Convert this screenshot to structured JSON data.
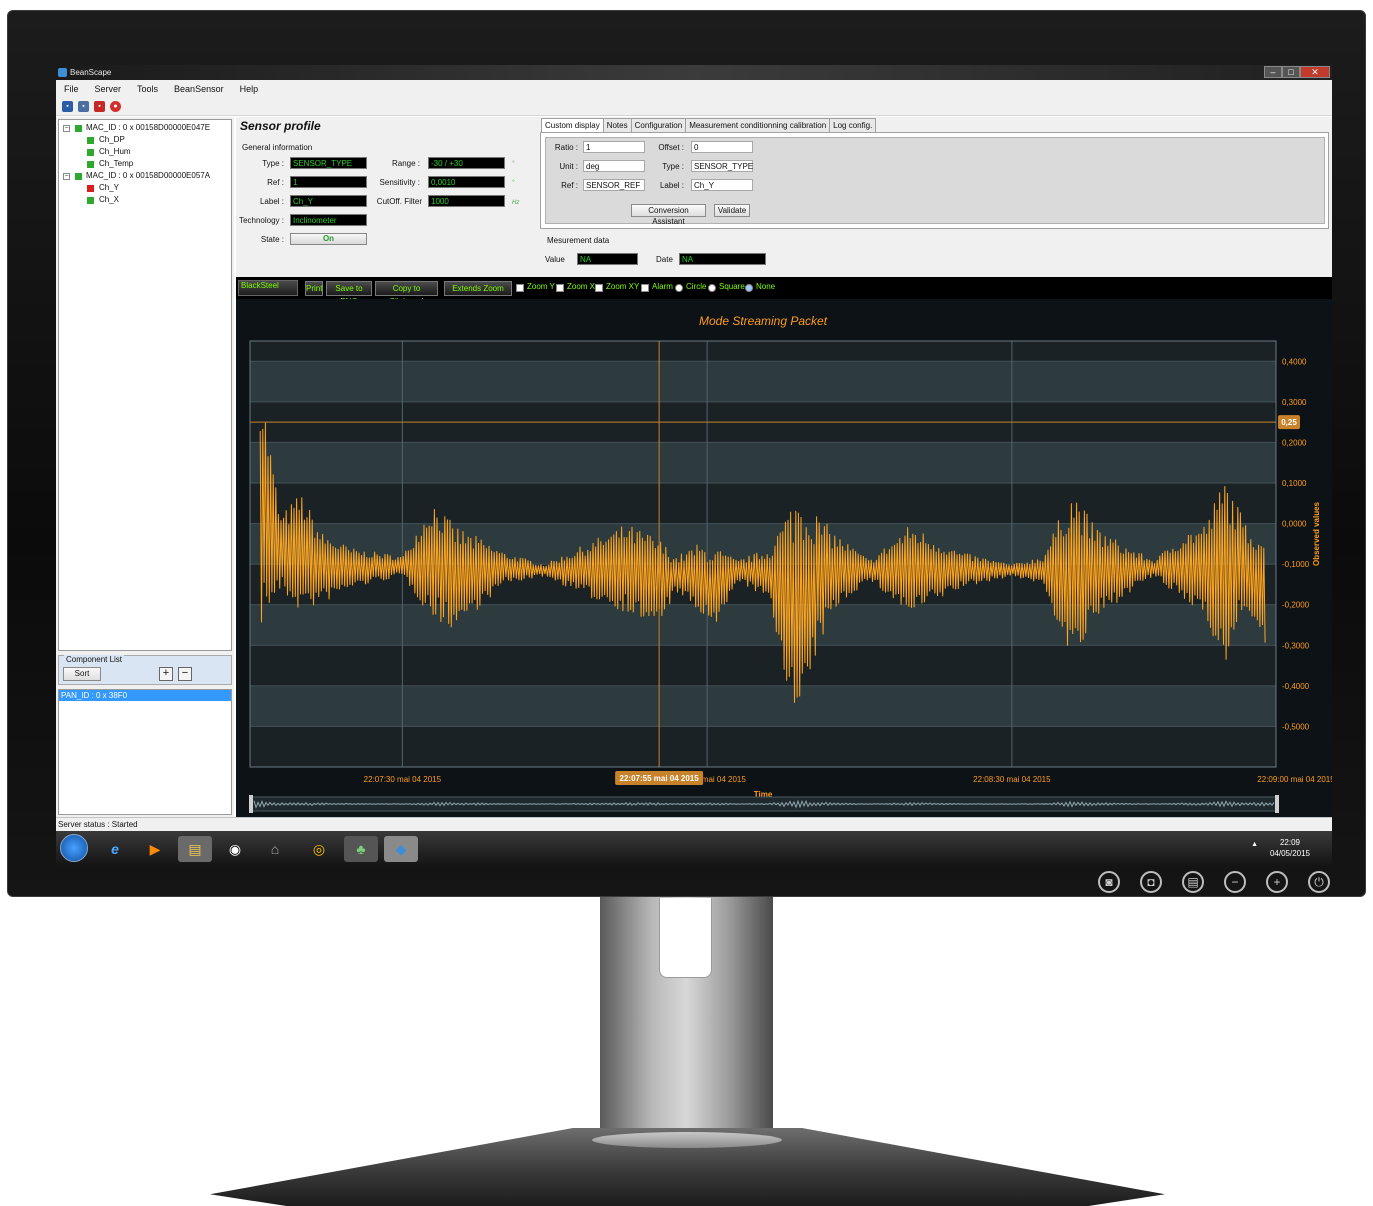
{
  "window": {
    "title": "BeanScape"
  },
  "menu": [
    "File",
    "Server",
    "Tools",
    "BeanSensor",
    "Help"
  ],
  "tree": [
    {
      "label": "MAC_ID : 0 x 00158D00000E047E",
      "level": 0,
      "status": "green",
      "expander": "−"
    },
    {
      "label": "Ch_DP",
      "level": 1,
      "status": "green"
    },
    {
      "label": "Ch_Hum",
      "level": 1,
      "status": "green"
    },
    {
      "label": "Ch_Temp",
      "level": 1,
      "status": "green"
    },
    {
      "label": "MAC_ID : 0 x 00158D00000E057A",
      "level": 0,
      "status": "green",
      "expander": "−"
    },
    {
      "label": "Ch_Y",
      "level": 1,
      "status": "red"
    },
    {
      "label": "Ch_X",
      "level": 1,
      "status": "green"
    }
  ],
  "component_list": {
    "title": "Component List",
    "sort_label": "Sort",
    "plus": "+",
    "minus": "−"
  },
  "pan_list": [
    "PAN_ID : 0 x 38F0"
  ],
  "status": "Server status : Started",
  "profile": {
    "title": "Sensor profile",
    "general_info": "General information",
    "type_label": "Type :",
    "type_value": "SENSOR_TYPE",
    "ref_label": "Ref :",
    "ref_value": "1",
    "label_label": "Label :",
    "label_value": "Ch_Y",
    "technology_label": "Technology :",
    "technology_value": "Inclinometer",
    "state_label": "State :",
    "state_value": "On",
    "range_label": "Range :",
    "range_value": "-30 / +30",
    "range_unit": "°",
    "sensitivity_label": "Sensitivity :",
    "sensitivity_value": "0,0010",
    "sensitivity_unit": "°",
    "cutoff_label": "CutOff. Filter",
    "cutoff_value": "1000",
    "cutoff_unit": "Hz"
  },
  "tabs": [
    "Custom display",
    "Notes",
    "Configuration",
    "Measurement conditionning calibration",
    "Log config."
  ],
  "custom_display": {
    "ratio_label": "Ratio :",
    "ratio_value": "1",
    "offset_label": "Offset :",
    "offset_value": "0",
    "unit_label": "Unit :",
    "unit_value": "deg",
    "type_label": "Type :",
    "type_value": "SENSOR_TYPE",
    "ref_label": "Ref :",
    "ref_value": "SENSOR_REF",
    "label_label": "Label :",
    "label_value": "Ch_Y",
    "conversion_button": "Conversion Assistant",
    "validate_button": "Validate"
  },
  "measurement": {
    "title": "Mesurement data",
    "value_label": "Value",
    "value": "NA",
    "date_label": "Date",
    "date": "NA"
  },
  "chart_toolbar": {
    "skin": "BlackSteel",
    "print": "Print",
    "save_png": "Save to PNG",
    "copy": "Copy to Clipboard",
    "extends_zoom": "Extends Zoom",
    "zoom_y": "Zoom Y",
    "zoom_x": "Zoom X",
    "zoom_xy": "Zoom XY",
    "alarm": "Alarm",
    "circle": "Circle",
    "square": "Square",
    "none": "None"
  },
  "chart_data": {
    "type": "line",
    "title": "Mode Streaming Packet",
    "xlabel": "Time",
    "ylabel": "Observed values",
    "ylim": [
      -0.6,
      0.45
    ],
    "y_ticks": [
      "0,4000",
      "0,3000",
      "0,2000",
      "0,1000",
      "0,0000",
      "-0,1000",
      "-0,2000",
      "-0,3000",
      "-0,4000",
      "-0,5000"
    ],
    "x_ticks": [
      "22:07:30 mai 04 2015",
      "22:08:00 mai 04 2015",
      "22:08:30 mai 04 2015",
      "22:09:00 mai 04 2015"
    ],
    "x_range_seconds": [
      -45,
      56
    ],
    "cursor_time_label": "22:07:55 mai 04 2015",
    "cursor_value_label": "0,25",
    "cursor_value": 0.25,
    "line_color": "#ffa51e",
    "grid": true,
    "envelope": [
      {
        "t": -44,
        "max": 0.37,
        "min": -0.26
      },
      {
        "t": -42,
        "max": 0.02,
        "min": -0.17
      },
      {
        "t": -40,
        "max": 0.08,
        "min": -0.22
      },
      {
        "t": -38,
        "max": -0.02,
        "min": -0.2
      },
      {
        "t": -35,
        "max": -0.06,
        "min": -0.16
      },
      {
        "t": -30,
        "max": -0.08,
        "min": -0.13
      },
      {
        "t": -27,
        "max": 0.06,
        "min": -0.24
      },
      {
        "t": -25,
        "max": 0.0,
        "min": -0.26
      },
      {
        "t": -22,
        "max": -0.04,
        "min": -0.2
      },
      {
        "t": -20,
        "max": -0.07,
        "min": -0.15
      },
      {
        "t": -16,
        "max": -0.1,
        "min": -0.13
      },
      {
        "t": -12,
        "max": -0.05,
        "min": -0.18
      },
      {
        "t": -8,
        "max": 0.0,
        "min": -0.22
      },
      {
        "t": -5,
        "max": -0.03,
        "min": -0.26
      },
      {
        "t": -3,
        "max": -0.08,
        "min": -0.17
      },
      {
        "t": -1,
        "max": -0.05,
        "min": -0.22
      },
      {
        "t": 1,
        "max": -0.06,
        "min": -0.26
      },
      {
        "t": 3,
        "max": -0.09,
        "min": -0.14
      },
      {
        "t": 6,
        "max": -0.06,
        "min": -0.19
      },
      {
        "t": 9,
        "max": 0.09,
        "min": -0.52
      },
      {
        "t": 11,
        "max": 0.02,
        "min": -0.3
      },
      {
        "t": 13,
        "max": -0.03,
        "min": -0.2
      },
      {
        "t": 16,
        "max": -0.09,
        "min": -0.14
      },
      {
        "t": 20,
        "max": 0.0,
        "min": -0.23
      },
      {
        "t": 22,
        "max": -0.03,
        "min": -0.2
      },
      {
        "t": 25,
        "max": -0.07,
        "min": -0.16
      },
      {
        "t": 30,
        "max": -0.1,
        "min": -0.13
      },
      {
        "t": 33,
        "max": -0.08,
        "min": -0.15
      },
      {
        "t": 36,
        "max": 0.09,
        "min": -0.35
      },
      {
        "t": 38,
        "max": 0.0,
        "min": -0.25
      },
      {
        "t": 41,
        "max": -0.05,
        "min": -0.18
      },
      {
        "t": 44,
        "max": -0.09,
        "min": -0.13
      },
      {
        "t": 47,
        "max": -0.02,
        "min": -0.2
      },
      {
        "t": 49,
        "max": 0.0,
        "min": -0.22
      },
      {
        "t": 51,
        "max": 0.12,
        "min": -0.37
      },
      {
        "t": 53,
        "max": 0.0,
        "min": -0.2
      },
      {
        "t": 55,
        "max": -0.02,
        "min": -0.34
      }
    ]
  },
  "taskbar": {
    "time": "22:09",
    "date": "04/05/2015"
  },
  "monitor_buttons": [
    "◙",
    "◘",
    "▤",
    "−",
    "+",
    "⏻"
  ]
}
